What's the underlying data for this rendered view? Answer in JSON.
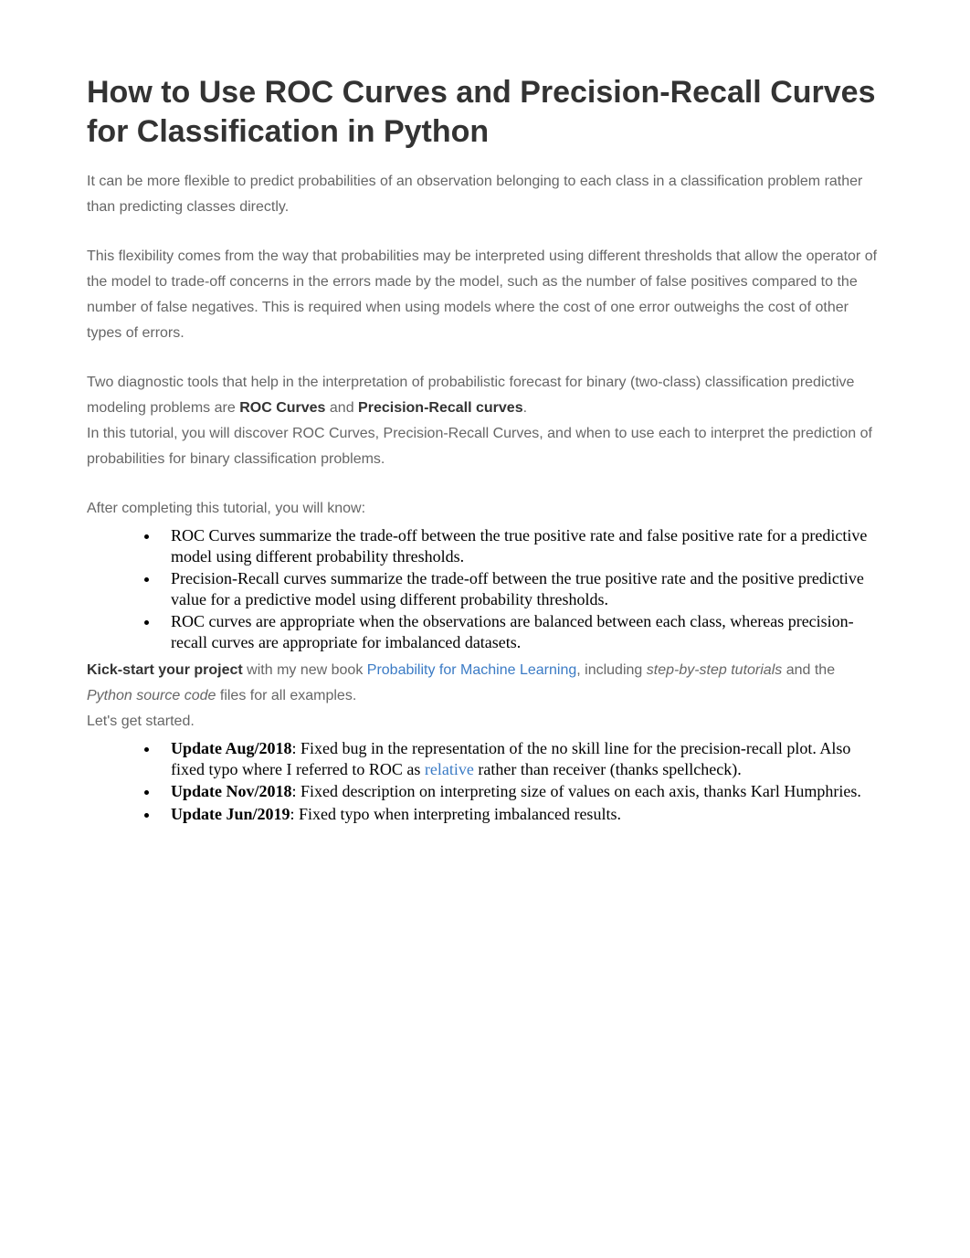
{
  "title": "How to Use ROC Curves and Precision-Recall Curves for Classification in Python",
  "para1": "It can be more flexible to predict probabilities of an observation belonging to each class in a classification problem rather than predicting classes directly.",
  "para2": "This flexibility comes from the way that probabilities may be interpreted using different thresholds that allow the operator of the model to trade-off concerns in the errors made by the model, such as the number of false positives compared to the number of false negatives. This is required when using models where the cost of one error outweighs the cost of other types of errors.",
  "para3_part1": "Two diagnostic tools that help in the interpretation of probabilistic forecast for binary (two-class) classification predictive modeling problems are ",
  "para3_bold1": "ROC Curves",
  "para3_part2": " and ",
  "para3_bold2": "Precision-Recall curves",
  "para3_part3": ".",
  "para4": "In this tutorial, you will discover ROC Curves, Precision-Recall Curves, and when to use each to interpret the prediction of probabilities for binary classification problems.",
  "para5": "After completing this tutorial, you will know:",
  "bullets": {
    "b1": "ROC Curves summarize the trade-off between the true positive rate and false positive rate for a predictive model using different probability thresholds.",
    "b2": "Precision-Recall curves summarize the trade-off between the true positive rate and the positive predictive value for a predictive model using different probability thresholds.",
    "b3": "ROC curves are appropriate when the observations are balanced between each class, whereas precision-recall curves are appropriate for imbalanced datasets."
  },
  "kickstart_bold": "Kick-start your project",
  "kickstart_part1": " with my new book ",
  "kickstart_link": "Probability for Machine Learning",
  "kickstart_part2": ", including ",
  "kickstart_italic1": "step-by-step tutorials",
  "kickstart_part3": " and the ",
  "kickstart_italic2": "Python source code",
  "kickstart_part4": " files for all examples.",
  "para_lets": "Let's get started.",
  "updates": {
    "u1_bold": "Update Aug/2018",
    "u1_part1": ": Fixed bug in the representation of the no skill line for the precision-recall plot. Also fixed typo where I referred to ROC as ",
    "u1_link": "relative",
    "u1_part2": " rather than receiver (thanks spellcheck).",
    "u2_bold": "Update Nov/2018",
    "u2_text": ": Fixed description on interpreting size of values on each axis, thanks Karl Humphries.",
    "u3_bold": "Update Jun/2019",
    "u3_text": ": Fixed typo when interpreting imbalanced results."
  }
}
